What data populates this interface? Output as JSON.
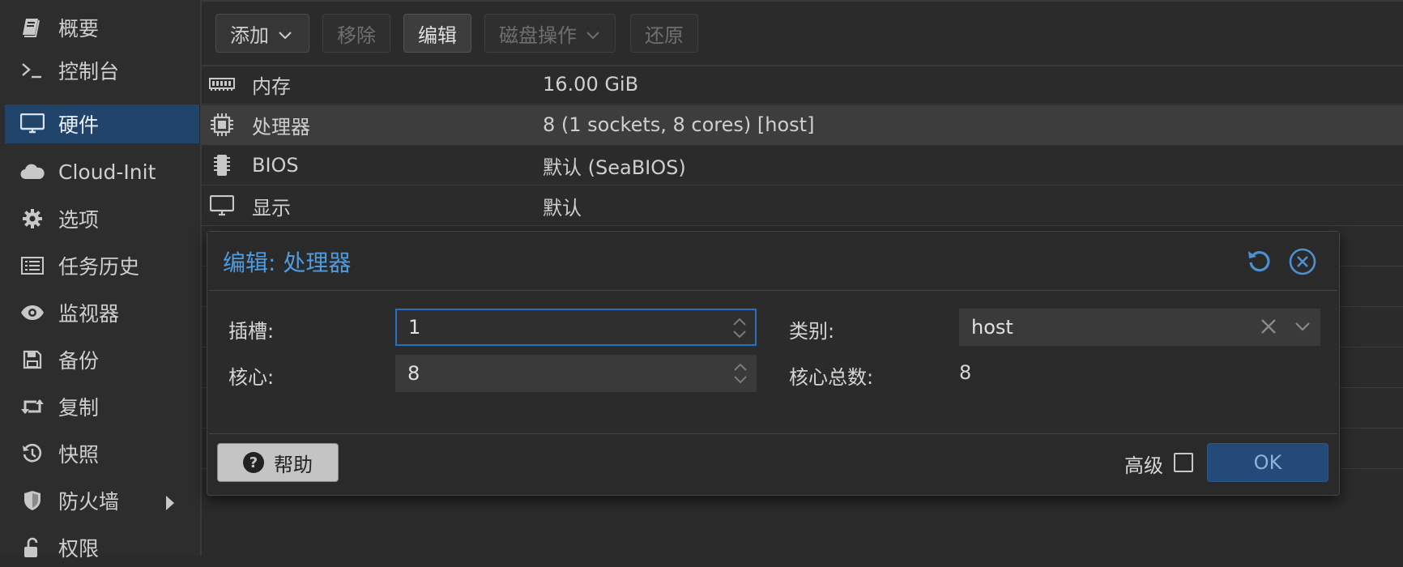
{
  "sidebar": {
    "items": [
      {
        "label": "概要",
        "icon": "book-icon"
      },
      {
        "label": "控制台",
        "icon": "terminal-icon"
      },
      {
        "label": "硬件",
        "icon": "desktop-icon",
        "active": true
      },
      {
        "label": "Cloud-Init",
        "icon": "cloud-icon"
      },
      {
        "label": "选项",
        "icon": "gear-icon"
      },
      {
        "label": "任务历史",
        "icon": "list-icon"
      },
      {
        "label": "监视器",
        "icon": "eye-icon"
      },
      {
        "label": "备份",
        "icon": "floppy-icon"
      },
      {
        "label": "复制",
        "icon": "retweet-icon"
      },
      {
        "label": "快照",
        "icon": "history-icon"
      },
      {
        "label": "防火墙",
        "icon": "shield-icon"
      },
      {
        "label": "权限",
        "icon": "unlock-icon"
      }
    ]
  },
  "toolbar": {
    "add_label": "添加",
    "remove_label": "移除",
    "edit_label": "编辑",
    "disk_action_label": "磁盘操作",
    "revert_label": "还原"
  },
  "hardware": {
    "rows": [
      {
        "name": "内存",
        "value": "16.00 GiB",
        "icon": "memory-icon"
      },
      {
        "name": "处理器",
        "value": "8 (1 sockets, 8 cores) [host]",
        "icon": "cpu-icon",
        "selected": true
      },
      {
        "name": "BIOS",
        "value": "默认 (SeaBIOS)",
        "icon": "microchip-icon"
      },
      {
        "name": "显示",
        "value": "默认",
        "icon": "desktop-icon"
      }
    ]
  },
  "dialog": {
    "title": "编辑: 处理器",
    "sockets_label": "插槽:",
    "sockets_value": "1",
    "cores_label": "核心:",
    "cores_value": "8",
    "type_label": "类别:",
    "type_value": "host",
    "total_cores_label": "核心总数:",
    "total_cores_value": "8",
    "help_label": "帮助",
    "advanced_label": "高级",
    "advanced_checked": false,
    "ok_label": "OK"
  },
  "colors": {
    "accent": "#4e9be0",
    "sidebar_active": "#21446b",
    "ok_button": "#234a78",
    "focus_border": "#2c6fc0"
  }
}
